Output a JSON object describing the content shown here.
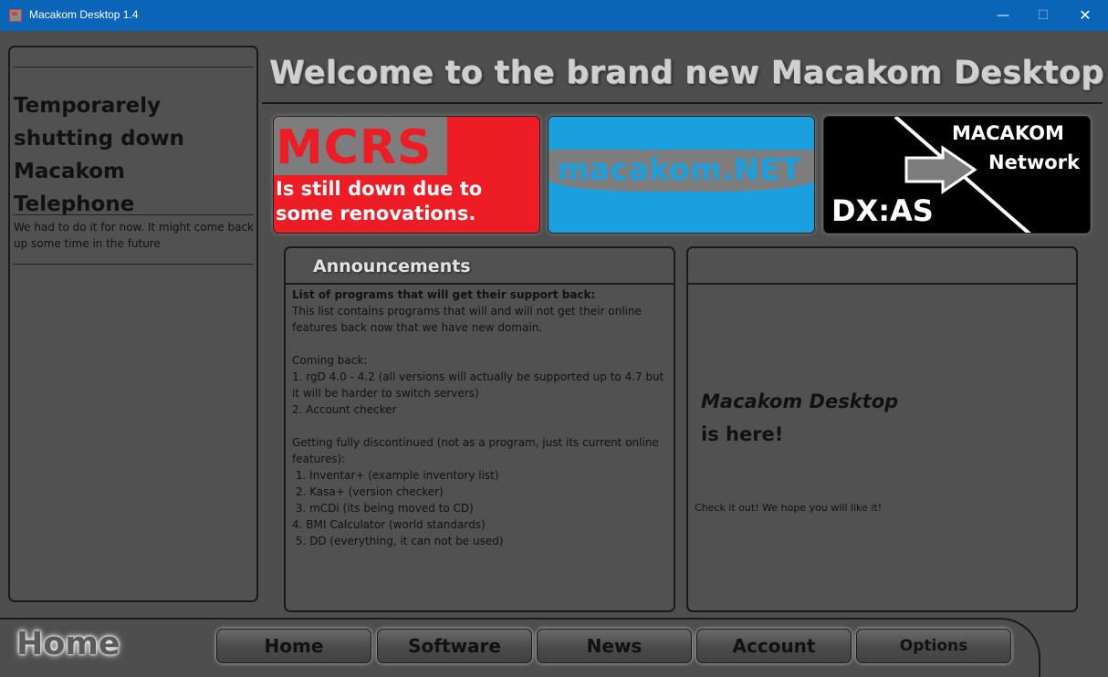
{
  "window": {
    "title": "Macakom Desktop 1.4",
    "minimize_label": "—",
    "maximize_label": "☐",
    "close_label": "✕"
  },
  "left_panel": {
    "headline": "Temporarely shutting down Macakom Telephone",
    "body": "We had to do it for now. It might come back up some time in the future"
  },
  "welcome": "Welcome to the brand new Macakom Desktop!!!",
  "banners": {
    "mcrs": {
      "title": "MCRS",
      "subtitle": "Is still down due to some renovations.",
      "color": "#ee1c24"
    },
    "net": {
      "title": "macakom.NET",
      "color": "#1aa0de"
    },
    "dxas": {
      "line1": "MACAKOM",
      "line2": "Network",
      "line3": "DX:AS",
      "icon": "arrow-right-icon"
    }
  },
  "announcements": {
    "heading": "Announcements",
    "title": "List of programs that will get their support back:",
    "body": "This list contains programs that will and will not get their online features back now that we have new domain.\n\nComing back:\n1. rgD 4.0 - 4.2 (all versions will actually be supported up to 4.7 but it will be harder to switch servers)\n2. Account checker\n\nGetting fully discontinued (not as a program, just its current online features):\n 1. Inventar+ (example inventory list)\n 2. Kasa+ (version checker)\n 3. mCDi (its being moved to CD)\n4. BMI Calculator (world standards)\n 5. DD (everything, it can not be used)"
  },
  "right_panel": {
    "line1": "Macakom Desktop",
    "line2": "is here!",
    "small": "Check it out! We hope you will like it!"
  },
  "nav": {
    "current": "Home",
    "buttons": [
      "Home",
      "Software",
      "News",
      "Account",
      "Options"
    ]
  }
}
